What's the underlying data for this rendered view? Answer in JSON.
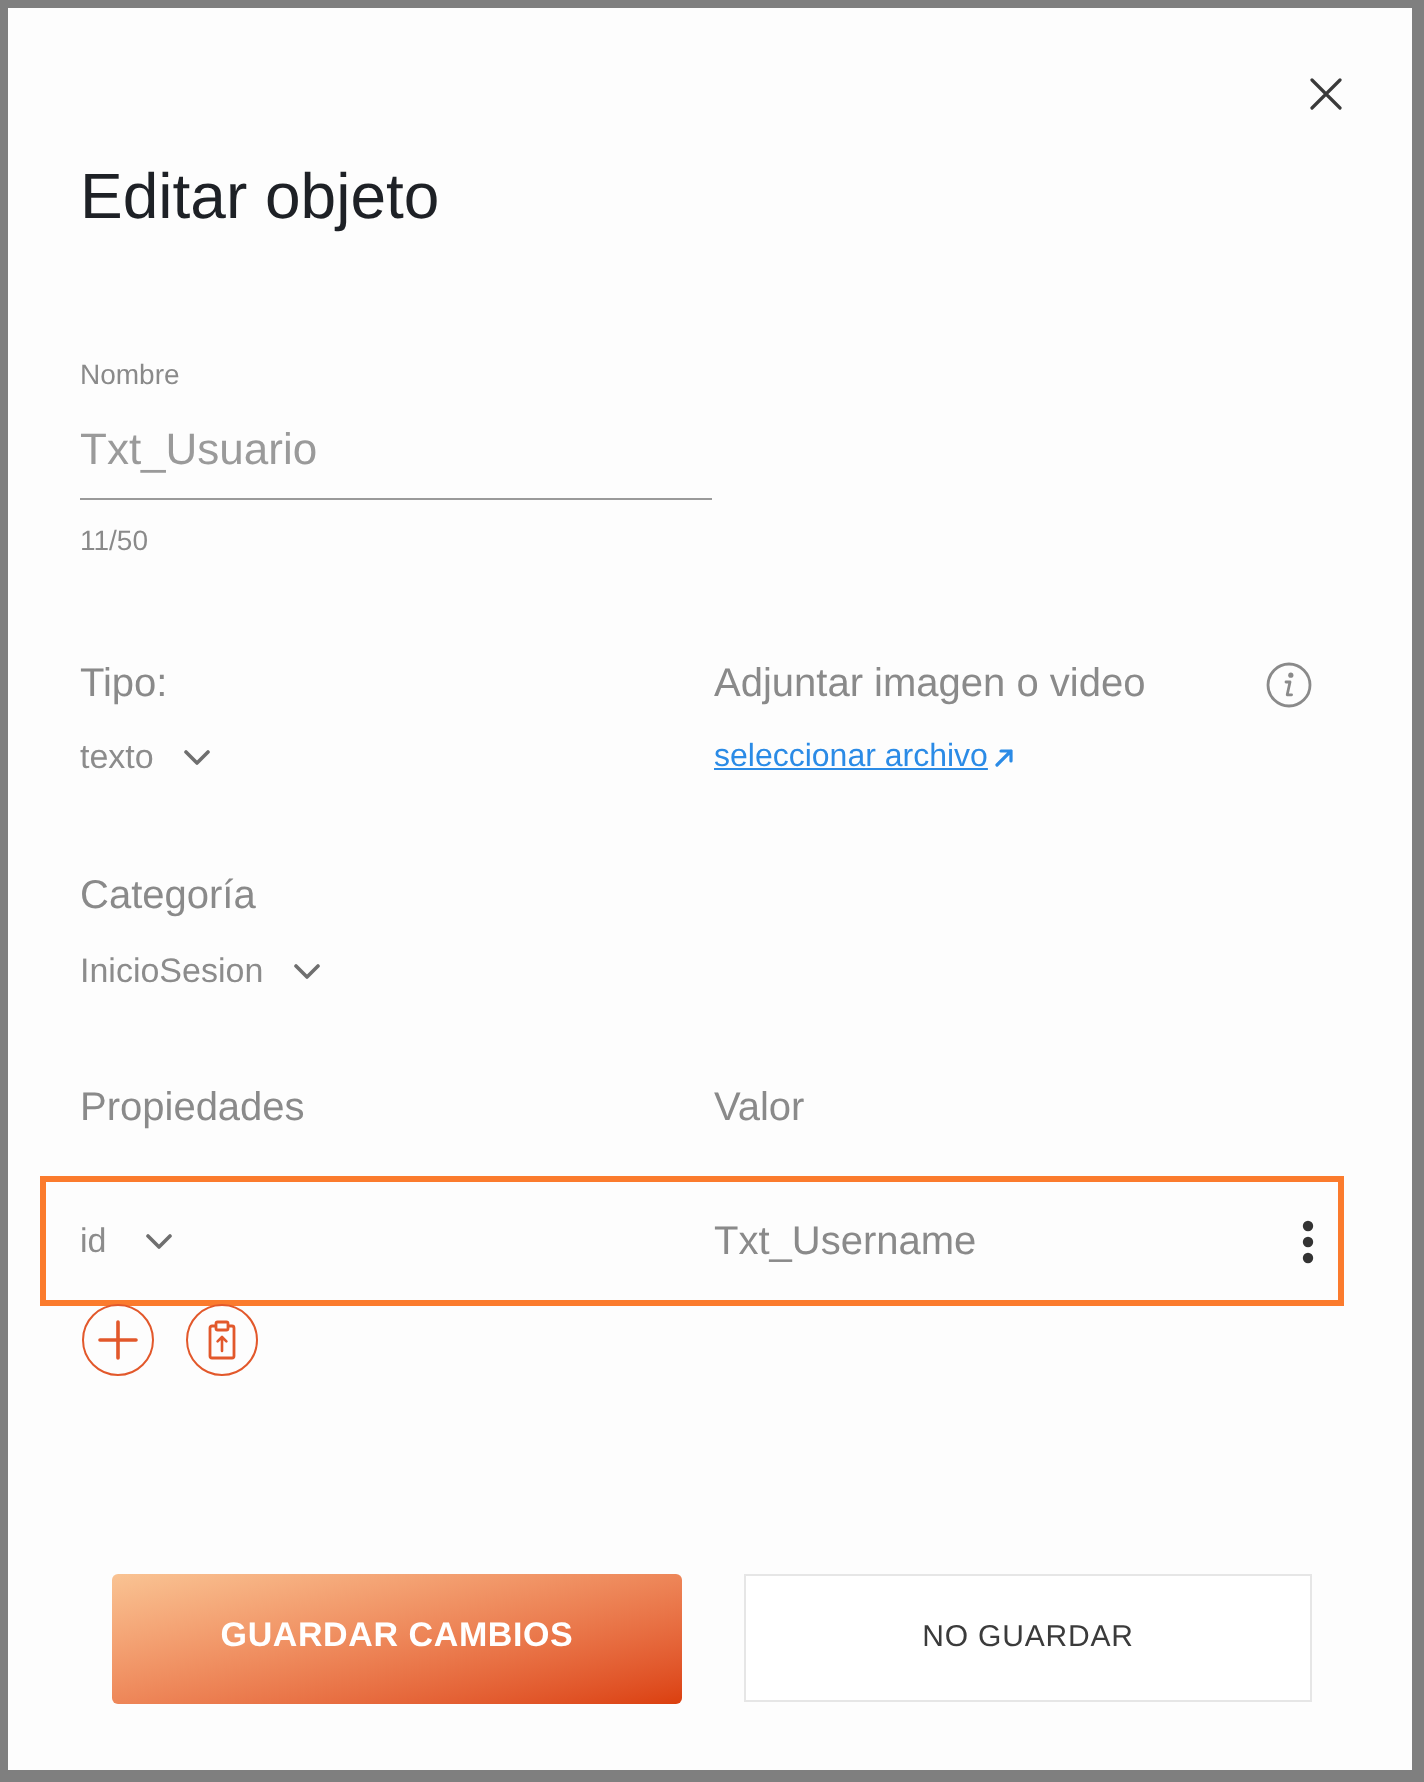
{
  "dialog": {
    "title": "Editar objeto"
  },
  "name_field": {
    "label": "Nombre",
    "value": "Txt_Usuario",
    "counter": "11/50"
  },
  "type_field": {
    "label": "Tipo:",
    "value": "texto"
  },
  "attachment": {
    "label": "Adjuntar imagen o video",
    "link": "seleccionar archivo"
  },
  "category_field": {
    "label": "Categoría",
    "value": "InicioSesion"
  },
  "properties": {
    "columns": [
      "Propiedades",
      "Valor"
    ],
    "rows": [
      {
        "property": "id",
        "value": "Txt_Username",
        "selected": true
      }
    ]
  },
  "buttons": [
    {
      "label": "GUARDAR CAMBIOS",
      "kind": "primary"
    },
    {
      "label": "NO GUARDAR",
      "kind": "secondary"
    }
  ]
}
